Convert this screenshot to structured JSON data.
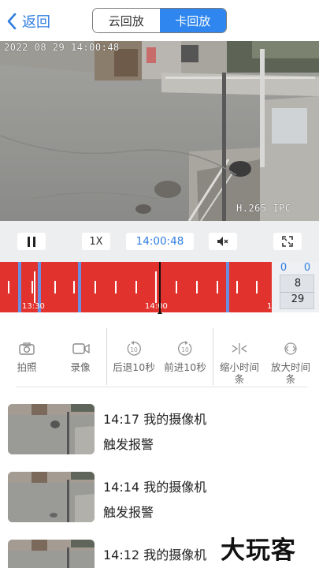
{
  "header": {
    "back_label": "返回",
    "tabs": [
      {
        "label": "云回放",
        "active": false
      },
      {
        "label": "卡回放",
        "active": true
      }
    ]
  },
  "video": {
    "osd_timestamp": "2022 08 29 14:00:48",
    "osd_codec": "H.265 IPC"
  },
  "controls": {
    "speed_label": "1X",
    "time_label": "14:00:48"
  },
  "timeline": {
    "labels": [
      "13:30",
      "14:00",
      "1"
    ],
    "date": {
      "top_left": "0",
      "top_right": "0",
      "month": "8",
      "day": "29"
    }
  },
  "tools": [
    {
      "label": "拍照",
      "icon": "camera-icon"
    },
    {
      "label": "录像",
      "icon": "video-record-icon"
    },
    {
      "label": "后退10秒",
      "icon": "rewind-10-icon"
    },
    {
      "label": "前进10秒",
      "icon": "forward-10-icon"
    },
    {
      "label": "缩小时间条",
      "icon": "zoom-in-timeline-icon"
    },
    {
      "label": "放大时间条",
      "icon": "zoom-out-timeline-icon"
    }
  ],
  "events": [
    {
      "title": "14:17 我的摄像机",
      "subtitle": "触发报警"
    },
    {
      "title": "14:14 我的摄像机",
      "subtitle": "触发报警"
    },
    {
      "title": "14:12 我的摄像机",
      "subtitle": ""
    }
  ],
  "watermark": "大玩客",
  "colors": {
    "accent": "#2e86ee",
    "timeline": "#e1322d",
    "timeline_gap": "#6a8fe0"
  }
}
